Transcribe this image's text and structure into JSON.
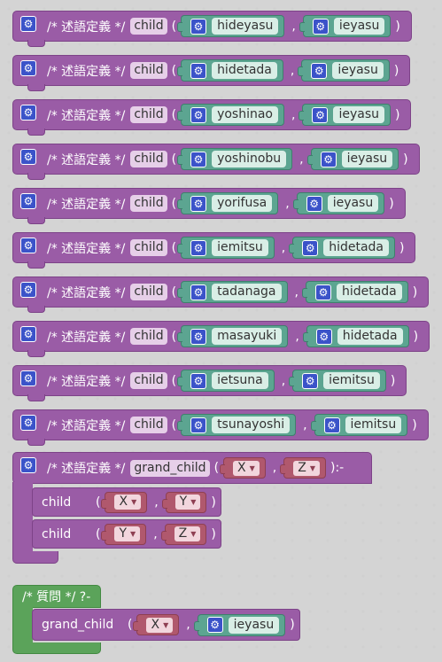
{
  "labels": {
    "comment": "/* 述語定義 */",
    "query_comment": "/* 質問 */ ?-",
    "open_paren": "(",
    "close_paren": ")",
    "comma": ",",
    "rule_neck": "):-"
  },
  "icons": {
    "block": "gear-icon",
    "dropdown": "dropdown-arrow-icon"
  },
  "colors": {
    "predicate_block": "#9a5ca6",
    "atom_block": "#5ca591",
    "variable_block": "#b0586d",
    "query_block": "#5ba35a",
    "gear_badge": "#3b53c9"
  },
  "facts": [
    {
      "predicate": "child",
      "arg1": "hideyasu",
      "arg2": "ieyasu"
    },
    {
      "predicate": "child",
      "arg1": "hidetada",
      "arg2": "ieyasu"
    },
    {
      "predicate": "child",
      "arg1": "yoshinao",
      "arg2": "ieyasu"
    },
    {
      "predicate": "child",
      "arg1": "yoshinobu",
      "arg2": "ieyasu"
    },
    {
      "predicate": "child",
      "arg1": "yorifusa",
      "arg2": "ieyasu"
    },
    {
      "predicate": "child",
      "arg1": "iemitsu",
      "arg2": "hidetada"
    },
    {
      "predicate": "child",
      "arg1": "tadanaga",
      "arg2": "hidetada"
    },
    {
      "predicate": "child",
      "arg1": "masayuki",
      "arg2": "hidetada"
    },
    {
      "predicate": "child",
      "arg1": "ietsuna",
      "arg2": "iemitsu"
    },
    {
      "predicate": "child",
      "arg1": "tsunayoshi",
      "arg2": "iemitsu"
    }
  ],
  "rule": {
    "predicate": "grand_child",
    "head_var1": "X",
    "head_var2": "Z",
    "body": [
      {
        "predicate": "child",
        "var1": "X",
        "var2": "Y"
      },
      {
        "predicate": "child",
        "var1": "Y",
        "var2": "Z"
      }
    ]
  },
  "query": {
    "predicate": "grand_child",
    "var1": "X",
    "atom": "ieyasu"
  }
}
